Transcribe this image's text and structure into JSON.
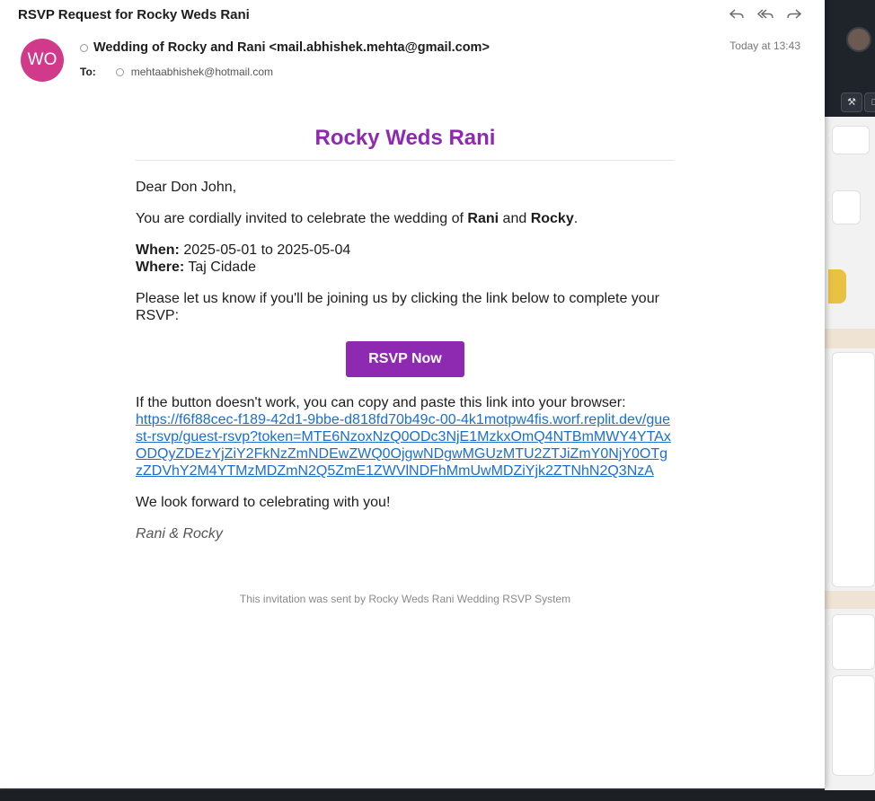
{
  "email": {
    "subject": "RSVP Request for Rocky Weds Rani",
    "sender_initials": "WO",
    "from": "Wedding of Rocky and Rani <mail.abhishek.mehta@gmail.com>",
    "to_label": "To:",
    "to": "mehtaabhishek@hotmail.com",
    "date": "Today at 13:43",
    "actions": {
      "reply_icon": "reply-icon",
      "reply_all_icon": "reply-all-icon",
      "forward_icon": "forward-icon"
    }
  },
  "invite": {
    "title": "Rocky Weds Rani",
    "greeting": "Dear Don John,",
    "intro_pre": "You are cordially invited to celebrate the wedding of ",
    "name1": "Rani",
    "intro_and": " and ",
    "name2": "Rocky",
    "intro_end": ".",
    "when_label": "When:",
    "when": " 2025-05-01 to 2025-05-04",
    "where_label": "Where:",
    "where": " Taj Cidade",
    "ask": "Please let us know if you'll be joining us by clicking the link below to complete your RSVP:",
    "button": "RSVP Now",
    "fallback": "If the button doesn't work, you can copy and paste this link into your browser:",
    "link": "https://f6f88cec-f189-42d1-9bbe-d818fd70b49c-00-4k1motpw4fis.worf.replit.dev/guest-rsvp/guest-rsvp?token=MTE6NzoxNzQ0ODc3NjE1MzkxOmQ4NTBmMWY4YTAxODQyZDEzYjZiY2FkNzZmNDEwZWQ0OjgwNDgwMGUzMTU2ZTJiZmY0NjY0OTgzZDVhY2M4YTMzMDZmN2Q5ZmE1ZWVlNDFhMmUwMDZiYjk2ZTNhN2Q3NzA",
    "closing": "We look forward to celebrating with you!",
    "signature": "Rani & Rocky",
    "footer": "This invitation was sent by Rocky Weds Rani Wedding RSVP System"
  },
  "colors": {
    "accent": "#8e2ab2",
    "avatar": "#d13a8a",
    "link": "#1a6fd0"
  }
}
